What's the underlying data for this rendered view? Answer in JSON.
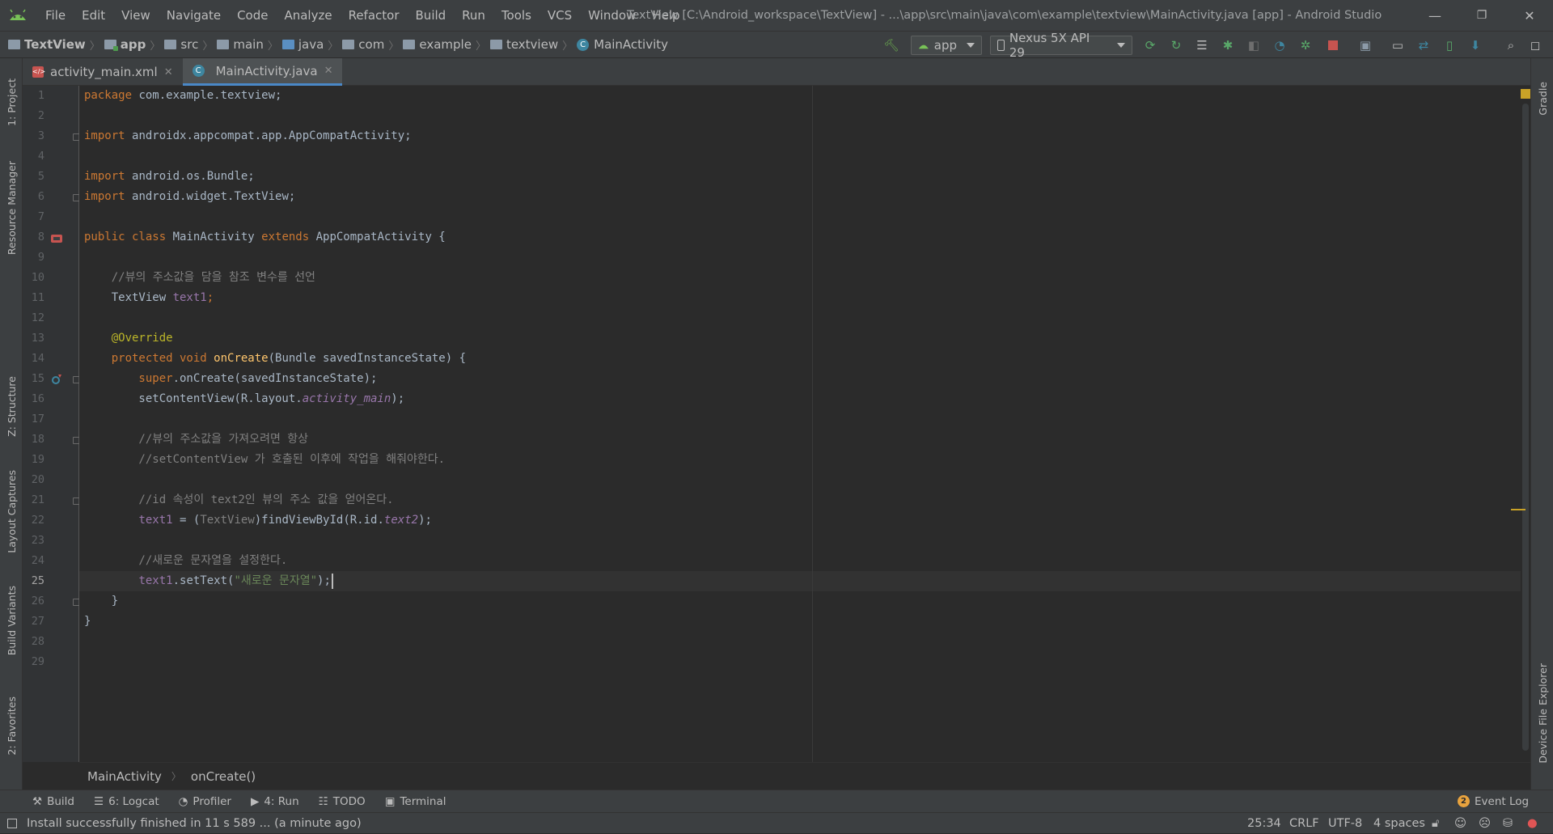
{
  "title_bar": {
    "menu": [
      "File",
      "Edit",
      "View",
      "Navigate",
      "Code",
      "Analyze",
      "Refactor",
      "Build",
      "Run",
      "Tools",
      "VCS",
      "Window",
      "Help"
    ],
    "window_title": "TextView [C:\\Android_workspace\\TextView] - ...\\app\\src\\main\\java\\com\\example\\textview\\MainActivity.java [app] - Android Studio",
    "minimize": "—",
    "restore": "❐",
    "close": "✕"
  },
  "nav_bar": {
    "breadcrumbs": [
      "TextView",
      "app",
      "src",
      "main",
      "java",
      "com",
      "example",
      "textview",
      "MainActivity"
    ],
    "run_config": "app",
    "device": "Nexus 5X API 29"
  },
  "tabs": [
    {
      "label": "activity_main.xml",
      "active": false
    },
    {
      "label": "MainActivity.java",
      "active": true
    }
  ],
  "left_tools": [
    "1: Project",
    "Resource Manager",
    "Z: Structure",
    "Layout Captures",
    "Build Variants",
    "2: Favorites"
  ],
  "right_tools": [
    "Gradle",
    "Device File Explorer"
  ],
  "editor": {
    "line_numbers": [
      "1",
      "2",
      "3",
      "4",
      "5",
      "6",
      "7",
      "8",
      "9",
      "10",
      "11",
      "12",
      "13",
      "14",
      "15",
      "16",
      "17",
      "18",
      "19",
      "20",
      "21",
      "22",
      "23",
      "24",
      "25",
      "26",
      "27",
      "28",
      "29"
    ],
    "current_line": 25,
    "code": {
      "l1a": "package ",
      "l1b": "com.example.textview;",
      "l3a": "import ",
      "l3b": "androidx.appcompat.app.AppCompatActivity;",
      "l5a": "import ",
      "l5b": "android.os.Bundle;",
      "l6a": "import ",
      "l6b": "android.widget.TextView;",
      "l8a": "public class ",
      "l8b": "MainActivity ",
      "l8c": "extends ",
      "l8d": "AppCompatActivity {",
      "l10": "    //뷰의 주소값을 담을 참조 변수를 선언",
      "l11a": "    TextView ",
      "l11b": "text1",
      "l11c": ";",
      "l13": "    @Override",
      "l14a": "    protected void ",
      "l14b": "onCreate",
      "l14c": "(Bundle savedInstanceState) {",
      "l15a": "        super",
      "l15b": ".onCreate(savedInstanceState);",
      "l16a": "        setContentView(R.layout.",
      "l16b": "activity_main",
      "l16c": ");",
      "l18": "        //뷰의 주소값을 가져오려면 항상",
      "l19": "        //setContentView 가 호출된 이후에 작업을 해줘야한다.",
      "l21": "        //id 속성이 text2인 뷰의 주소 값을 얻어온다.",
      "l22a": "        ",
      "l22b": "text1",
      "l22c": " = (",
      "l22d": "TextView",
      "l22e": ")findViewById(R.id.",
      "l22f": "text2",
      "l22g": ");",
      "l24": "        //새로운 문자열을 설정한다.",
      "l25a": "        ",
      "l25b": "text1",
      "l25c": ".setText(",
      "l25d": "\"새로운 문자열\"",
      "l25e": ");",
      "l26": "    }",
      "l27": "}"
    },
    "breadcrumb": [
      "MainActivity",
      "onCreate()"
    ]
  },
  "tool_windows": [
    {
      "label": "Build"
    },
    {
      "label": "6: Logcat"
    },
    {
      "label": "Profiler"
    },
    {
      "label": "4: Run"
    },
    {
      "label": "TODO"
    },
    {
      "label": "Terminal"
    }
  ],
  "event_log": {
    "count": "2",
    "label": "Event Log"
  },
  "status_bar": {
    "message": "Install successfully finished in 11 s 589 ... (a minute ago)",
    "position": "25:34",
    "line_sep": "CRLF",
    "encoding": "UTF-8",
    "indent": "4 spaces"
  },
  "colors": {
    "accent": "#4a88c7",
    "keyword": "#cc7832",
    "string": "#6a8759",
    "field": "#9876aa",
    "method": "#ffc66d",
    "comment": "#808080"
  }
}
